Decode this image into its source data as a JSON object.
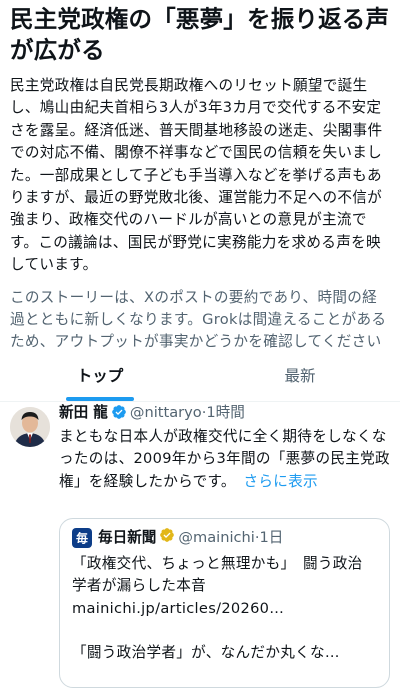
{
  "story": {
    "title": "民主党政権の「悪夢」を振り返る声が広がる",
    "body": "民主党政権は自民党長期政権へのリセット願望で誕生し、鳩山由紀夫首相ら3人が3年3カ月で交代する不安定さを露呈。経済低迷、普天間基地移設の迷走、尖閣事件での対応不備、閣僚不祥事などで国民の信頼を失いました。一部成果として子ども手当導入などを挙げる声もありますが、最近の野党敗北後、運営能力不足への不信が強まり、政権交代のハードルが高いとの意見が主流です。この議論は、国民が野党に実務能力を求める声を映しています。",
    "disclaimer": "このストーリーは、Xのポストの要約であり、時間の経過とともに新しくなります。Grokは間違えることがあるため、アウトプットが事実かどうかを確認してください"
  },
  "tabs": [
    {
      "label": "トップ",
      "active": true
    },
    {
      "label": "最新",
      "active": false
    }
  ],
  "post": {
    "author_name": "新田 龍",
    "handle": "@nittaryo",
    "separator": "·",
    "time": "1時間",
    "text": "まともな日本人が政権交代に全く期待をしなくなったのは、2009年から3年間の「悪夢の民主党政権」を経験したからです。",
    "show_more": "さらに表示",
    "verified_icon": "verified-badge-icon",
    "quote": {
      "name": "毎日新聞",
      "handle": "@mainichi",
      "separator": "·",
      "time": "1日",
      "headline": "「政権交代、ちょっと無理かも」　闘う政治学者が漏らした本音",
      "url": "mainichi.jp/articles/20260…",
      "line2": "「闘う政治学者」が、なんだか丸くな…",
      "logo_text": "毎"
    }
  },
  "colors": {
    "link": "#1d9bf0",
    "text": "#0f1419",
    "secondary": "#536471",
    "divider": "#eff3f4",
    "verified": "#1d9bf0"
  }
}
